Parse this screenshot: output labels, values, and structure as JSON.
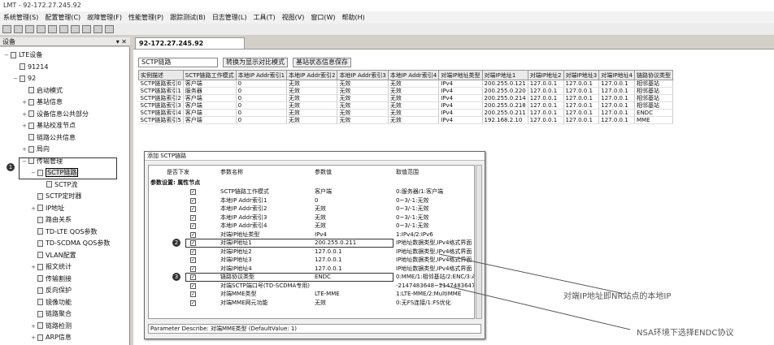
{
  "window": {
    "title": "LMT - 92-172.27.245.92"
  },
  "menu": [
    "系统管理(S)",
    "配置管理(C)",
    "故障管理(F)",
    "性能管理(P)",
    "跟踪测试(B)",
    "日志管理(L)",
    "工具(T)",
    "视图(V)",
    "窗口(W)",
    "帮助(H)"
  ],
  "devices_panel": {
    "title": "设备",
    "pins": "▾ ✕"
  },
  "tree": [
    {
      "label": "LTE设备",
      "depth": 0,
      "expander": "−"
    },
    {
      "label": "91214",
      "depth": 1,
      "expander": ""
    },
    {
      "label": "92",
      "depth": 1,
      "expander": "−"
    },
    {
      "label": "启动模式",
      "depth": 2,
      "expander": ""
    },
    {
      "label": "基站信息",
      "depth": 2,
      "expander": "+"
    },
    {
      "label": "设备信息公共部分",
      "depth": 2,
      "expander": "+"
    },
    {
      "label": "基站校准节点",
      "depth": 2,
      "expander": "+"
    },
    {
      "label": "链路公共信息",
      "depth": 2,
      "expander": ""
    },
    {
      "label": "局向",
      "depth": 2,
      "expander": "+"
    },
    {
      "label": "传输管理",
      "depth": 2,
      "expander": "−"
    },
    {
      "label": "SCTP链路",
      "depth": 3,
      "expander": "−",
      "selected": true
    },
    {
      "label": "SCTP流",
      "depth": 4,
      "expander": ""
    },
    {
      "label": "SCTP定时器",
      "depth": 3,
      "expander": ""
    },
    {
      "label": "IP地址",
      "depth": 3,
      "expander": "+"
    },
    {
      "label": "路由关系",
      "depth": 3,
      "expander": ""
    },
    {
      "label": "TD-LTE QOS参数",
      "depth": 3,
      "expander": ""
    },
    {
      "label": "TD-SCDMA QOS参数",
      "depth": 3,
      "expander": ""
    },
    {
      "label": "VLAN配置",
      "depth": 3,
      "expander": ""
    },
    {
      "label": "报文统计",
      "depth": 3,
      "expander": "+"
    },
    {
      "label": "传输割接",
      "depth": 3,
      "expander": ""
    },
    {
      "label": "反向保护",
      "depth": 3,
      "expander": ""
    },
    {
      "label": "镜像功能",
      "depth": 3,
      "expander": ""
    },
    {
      "label": "链路聚合",
      "depth": 3,
      "expander": ""
    },
    {
      "label": "链路检测",
      "depth": 3,
      "expander": "+"
    },
    {
      "label": "ARP信息",
      "depth": 3,
      "expander": "+"
    }
  ],
  "markers": [
    "1",
    "2",
    "3"
  ],
  "doc_tab": {
    "label": "92-172.27.245.92"
  },
  "subtoolbar": {
    "field": "SCTP链路",
    "btn1": "转换为显示对比模式",
    "btn2": "基站状态信息保存"
  },
  "table": {
    "headers": [
      "实例描述",
      "SCTP链路工作模式",
      "本地IP Addr索引1",
      "本地IP Addr索引2",
      "本地IP Addr索引3",
      "本地IP Addr索引4",
      "对端IP地址类型",
      "对端IP地址1",
      "对端IP地址2",
      "对端IP地址3",
      "对端IP地址4",
      "链路协议类型"
    ],
    "rows": [
      [
        "SCTP链路索引0",
        "客户端",
        "0",
        "无效",
        "无效",
        "无效",
        "IPv4",
        "200.255.0.121",
        "127.0.0.1",
        "127.0.0.1",
        "127.0.0.1",
        "相邻基站"
      ],
      [
        "SCTP链路索引1",
        "服务器",
        "0",
        "无效",
        "无效",
        "无效",
        "IPv4",
        "200.255.0.220",
        "127.0.0.1",
        "127.0.0.1",
        "127.0.0.1",
        "相邻基站"
      ],
      [
        "SCTP链路索引2",
        "客户端",
        "0",
        "无效",
        "无效",
        "无效",
        "IPv4",
        "200.255.0.214",
        "127.0.0.1",
        "127.0.0.1",
        "127.0.0.1",
        "相邻基站"
      ],
      [
        "SCTP链路索引3",
        "客户端",
        "0",
        "无效",
        "无效",
        "无效",
        "IPv4",
        "200.255.0.218",
        "127.0.0.1",
        "127.0.0.1",
        "127.0.0.1",
        "相邻基站"
      ],
      [
        "SCTP链路索引4",
        "客户端",
        "0",
        "无效",
        "无效",
        "无效",
        "IPv4",
        "200.255.0.211",
        "127.0.0.1",
        "127.0.0.1",
        "127.0.0.1",
        "ENDC"
      ],
      [
        "SCTP链路索引5",
        "客户端",
        "0",
        "无效",
        "无效",
        "无效",
        "IPv4",
        "192.168.2.10",
        "127.0.0.1",
        "127.0.0.1",
        "127.0.0.1",
        "MME"
      ]
    ]
  },
  "dialog": {
    "title": "添加 SCTP链路",
    "col_headers": [
      "是否下发",
      "参数名称",
      "参数值",
      "取值范围"
    ],
    "group": "参数设置: 属性节点",
    "params": [
      {
        "name": "SCTP链路工作模式",
        "value": "客户端",
        "range": "0:服务器/1:客户端"
      },
      {
        "name": "本地IP Addr索引1",
        "value": "0",
        "range": "0~3/-1:无效"
      },
      {
        "name": "本地IP Addr索引2",
        "value": "无效",
        "range": "0~3/-1:无效"
      },
      {
        "name": "本地IP Addr索引3",
        "value": "无效",
        "range": "0~3/-1:无效"
      },
      {
        "name": "本地IP Addr索引4",
        "value": "无效",
        "range": "0~3/-1:无效"
      },
      {
        "name": "对端IP地址类型",
        "value": "IPv4",
        "range": "1:IPv4/2:IPv6"
      },
      {
        "name": "对端IP地址1",
        "value": "200.255.0.211",
        "range": "IP地址数据类型,IPv4格式界面"
      },
      {
        "name": "对端IP地址2",
        "value": "127.0.0.1",
        "range": "IP地址数据类型,IPv4格式界面"
      },
      {
        "name": "对端IP地址3",
        "value": "127.0.0.1",
        "range": "IP地址数据类型,IPv4格式界面"
      },
      {
        "name": "对端IP地址4",
        "value": "127.0.0.1",
        "range": "IP地址数据类型,IPv4格式界面"
      },
      {
        "name": "链路协议类型",
        "value": "ENDC",
        "range": "0:MME/1:相邻基站/2:ENC/3:A"
      },
      {
        "name": "对端SCTP端口号(TD-SCDMA专用)",
        "value": "",
        "range": "-2147483648~2147483647"
      },
      {
        "name": "对端MME类型",
        "value": "LTE-MME",
        "range": "1:LTE-MME/2:MultiMME"
      },
      {
        "name": "对端MME网元功能",
        "value": "无效",
        "range": "0:无FS连接/1:FS优化"
      }
    ],
    "footer": "Parameter Describe: 对端MME类型 (DefaultValue: 1)"
  },
  "callouts": [
    "对端IP地址即NR站点的本地IP",
    "NSA环境下选择ENDC协议"
  ]
}
